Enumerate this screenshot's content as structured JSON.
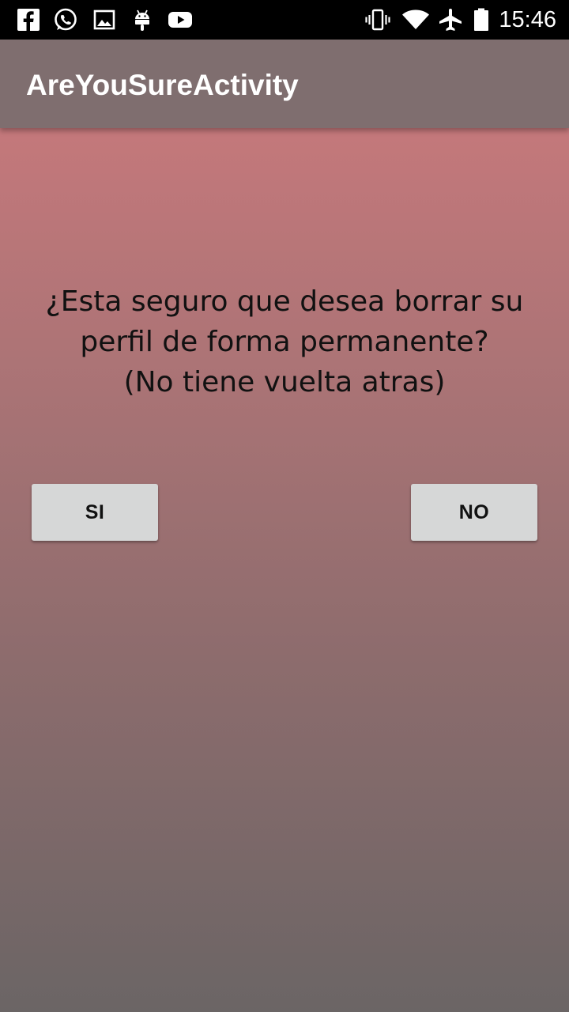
{
  "status_bar": {
    "time": "15:46",
    "left_icons": [
      "facebook-icon",
      "whatsapp-icon",
      "gallery-icon",
      "android-icon",
      "youtube-icon"
    ],
    "right_icons": [
      "vibrate-icon",
      "wifi-icon",
      "airplane-icon",
      "battery-icon"
    ]
  },
  "app_bar": {
    "title": "AreYouSureActivity"
  },
  "dialog": {
    "question_lines": [
      "¿Esta seguro que desea borrar su",
      "perfil de forma permanente?",
      "(No tiene vuelta atras)"
    ],
    "yes_label": "SI",
    "no_label": "NO"
  },
  "colors": {
    "app_bar": "#7f6e6f",
    "gradient_top": "#c4787b",
    "gradient_bottom": "#6b6565",
    "button": "#d6d7d7"
  }
}
